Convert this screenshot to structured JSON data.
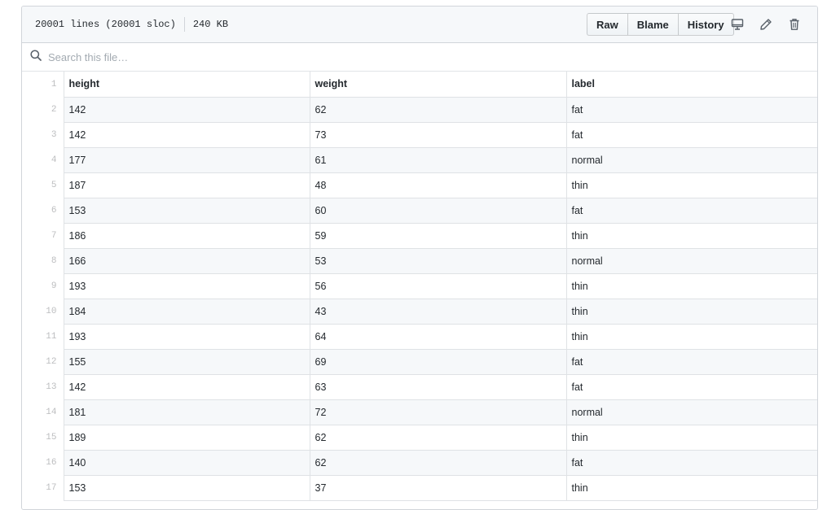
{
  "header": {
    "lines_info": "20001 lines (20001 sloc)",
    "size": "240 KB",
    "buttons": {
      "raw": "Raw",
      "blame": "Blame",
      "history": "History"
    },
    "icons": [
      "desktop-icon",
      "pencil-icon",
      "trash-icon"
    ]
  },
  "search": {
    "placeholder": "Search this file…",
    "value": ""
  },
  "table": {
    "headers": [
      "height",
      "weight",
      "label"
    ],
    "rows": [
      [
        "142",
        "62",
        "fat"
      ],
      [
        "142",
        "73",
        "fat"
      ],
      [
        "177",
        "61",
        "normal"
      ],
      [
        "187",
        "48",
        "thin"
      ],
      [
        "153",
        "60",
        "fat"
      ],
      [
        "186",
        "59",
        "thin"
      ],
      [
        "166",
        "53",
        "normal"
      ],
      [
        "193",
        "56",
        "thin"
      ],
      [
        "184",
        "43",
        "thin"
      ],
      [
        "193",
        "64",
        "thin"
      ],
      [
        "155",
        "69",
        "fat"
      ],
      [
        "142",
        "63",
        "fat"
      ],
      [
        "181",
        "72",
        "normal"
      ],
      [
        "189",
        "62",
        "thin"
      ],
      [
        "140",
        "62",
        "fat"
      ],
      [
        "153",
        "37",
        "thin"
      ]
    ]
  }
}
